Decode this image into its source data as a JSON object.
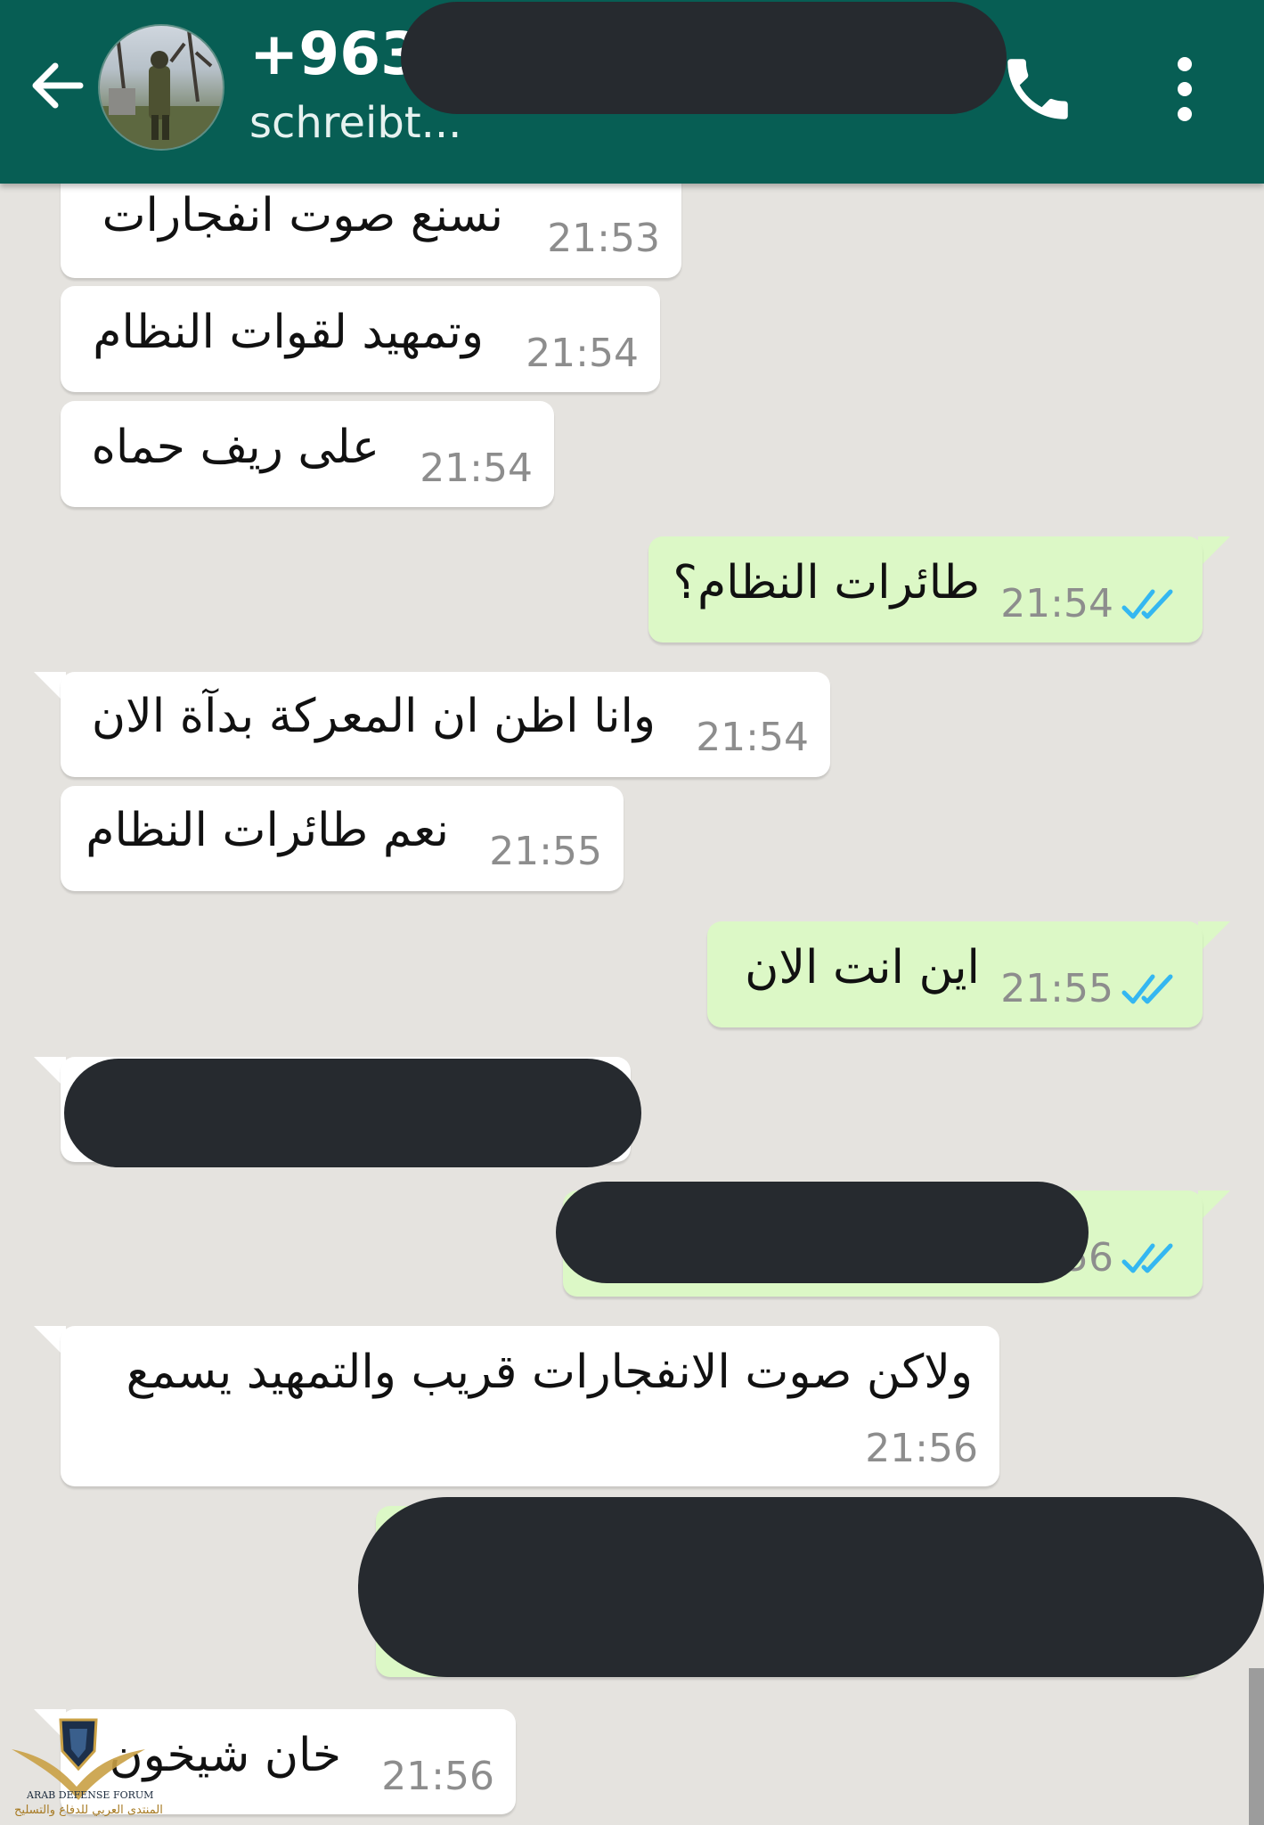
{
  "header": {
    "contact": "+963",
    "status": "schreibt...",
    "back_icon": "arrow-left-icon",
    "call_icon": "phone-icon",
    "menu_icon": "more-vert-icon",
    "color": "#075e54"
  },
  "messages": [
    {
      "dir": "in",
      "text": "نسنع صوت انفجارات",
      "time": "21:53"
    },
    {
      "dir": "in",
      "text": "وتمهيد لقوات النظام",
      "time": "21:54"
    },
    {
      "dir": "in",
      "text": "على ريف حماه",
      "time": "21:54"
    },
    {
      "dir": "out",
      "text": "طائرات النظام؟",
      "time": "21:54"
    },
    {
      "dir": "in",
      "text": "وانا اظن ان المعركة بدآة الان",
      "time": "21:54"
    },
    {
      "dir": "in",
      "text": "نعم طائرات النظام",
      "time": "21:55"
    },
    {
      "dir": "out",
      "text": "اين انت الان",
      "time": "21:55"
    },
    {
      "dir": "in",
      "text": "",
      "time": "",
      "redacted": true
    },
    {
      "dir": "out",
      "text": "",
      "time": "56",
      "redacted": true
    },
    {
      "dir": "in",
      "text": "ولاكن صوت الانفجارات قريب والتمهيد يسمع",
      "time": "21:56"
    },
    {
      "dir": "out",
      "text": "",
      "time": "",
      "redacted": true
    },
    {
      "dir": "in",
      "text": "خان شيخون",
      "time": "21:56"
    }
  ],
  "watermark": {
    "name": "ARAB DEFENSE FORUM",
    "arabic": "المنتدى العربي للدفاع والتسليح",
    "logo": "DA"
  },
  "colors": {
    "incoming": "#ffffff",
    "outgoing": "#dcf8c6",
    "background": "#e5e3df",
    "read_ticks": "#34b7f1"
  }
}
